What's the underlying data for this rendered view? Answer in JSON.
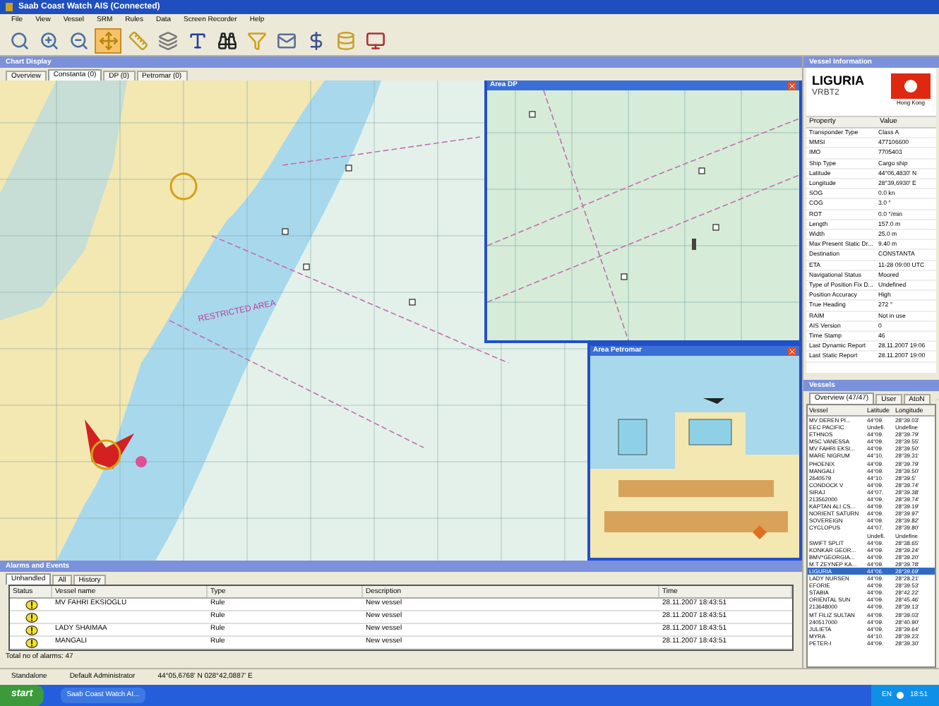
{
  "window": {
    "title": "Saab Coast Watch AIS (Connected)"
  },
  "menu": [
    "File",
    "View",
    "Vessel",
    "SRM",
    "Rules",
    "Data",
    "Screen Recorder",
    "Help"
  ],
  "toolbar": [
    {
      "kind": "search",
      "selected": false
    },
    {
      "kind": "zoom-in",
      "selected": false
    },
    {
      "kind": "zoom-out",
      "selected": false
    },
    {
      "kind": "pan",
      "selected": true
    },
    {
      "kind": "ruler",
      "selected": false
    },
    {
      "kind": "layers",
      "selected": false
    },
    {
      "kind": "text",
      "selected": false
    },
    {
      "kind": "binoculars",
      "selected": false
    },
    {
      "kind": "filter",
      "selected": false
    },
    {
      "kind": "mail",
      "selected": false
    },
    {
      "kind": "dollar",
      "selected": false
    },
    {
      "kind": "database",
      "selected": false
    },
    {
      "kind": "monitor",
      "selected": false
    }
  ],
  "chart_display": {
    "title": "Chart Display",
    "tabs": [
      {
        "label": "Overview",
        "selected": false
      },
      {
        "label": "Constanta (0)",
        "selected": true
      },
      {
        "label": "DP (0)",
        "selected": false
      },
      {
        "label": "Petromar (0)",
        "selected": false
      }
    ],
    "map_label": "RESTRICTED AREA",
    "area_windows": [
      {
        "title": "Area DP",
        "kind": "dp"
      },
      {
        "title": "Area Petromar",
        "kind": "harbor"
      }
    ]
  },
  "vessel_information": {
    "title": "Vessel Information",
    "name": "LIGURIA",
    "callsign": "VRBT2",
    "flag_caption": "Hong Kong",
    "columns": [
      "Property",
      "Value"
    ],
    "rows": [
      [
        "Transponder Type",
        "Class A"
      ],
      [
        "MMSI",
        "477106600"
      ],
      [
        "IMO",
        "7705403"
      ],
      [
        "Ship Type",
        "Cargo ship"
      ],
      [
        "Latitude",
        "44°06,4830' N"
      ],
      [
        "Longitude",
        "28°39,6930' E"
      ],
      [
        "SOG",
        "0.0 kn"
      ],
      [
        "COG",
        "3.0 °"
      ],
      [
        "ROT",
        "0.0 °/min"
      ],
      [
        "Length",
        "157.0 m"
      ],
      [
        "Width",
        "25.0 m"
      ],
      [
        "Max Present Static Dr...",
        "9.40 m"
      ],
      [
        "Destination",
        "CONSTANTA"
      ],
      [
        "ETA",
        "11-28 09:00 UTC"
      ],
      [
        "Navigational Status",
        "Moored"
      ],
      [
        "Type of Position Fix D...",
        "Undefined"
      ],
      [
        "Position Accuracy",
        "High"
      ],
      [
        "True Heading",
        "272 °"
      ],
      [
        "RAIM",
        "Not in use"
      ],
      [
        "AIS Version",
        "0"
      ],
      [
        "Time Stamp",
        "46"
      ],
      [
        "Last Dynamic Report",
        "28.11.2007 19:06"
      ],
      [
        "Last Static Report",
        "28.11.2007 19:00"
      ]
    ]
  },
  "vessels": {
    "title": "Vessels",
    "tabs": [
      {
        "label": "Overview (47/47)",
        "selected": true
      },
      {
        "label": "User",
        "selected": false
      },
      {
        "label": "AtoN",
        "selected": false
      }
    ],
    "columns": [
      "Vessel",
      "Latitude",
      "Longitude"
    ],
    "rows": [
      {
        "cells": [
          "MV DEREN PI...",
          "44°09.",
          "28°39.03'"
        ],
        "selected": false
      },
      {
        "cells": [
          "EEC PACIFIC",
          "Undefi.",
          "Undefine"
        ],
        "selected": false
      },
      {
        "cells": [
          "ETHNOS",
          "44°09.",
          "28°39.79'"
        ],
        "selected": false
      },
      {
        "cells": [
          "MSC VANESSA",
          "44°09.",
          "28°39.55'"
        ],
        "selected": false
      },
      {
        "cells": [
          "MV FAHRI EKSI...",
          "44°09.",
          "28°39.50'"
        ],
        "selected": false
      },
      {
        "cells": [
          "MARE NIGRUM",
          "44°10.",
          "28°39.31'"
        ],
        "selected": false
      },
      {
        "cells": [
          "PHOENIX",
          "44°09.",
          "28°39.79'"
        ],
        "selected": false
      },
      {
        "cells": [
          "MANGALI",
          "44°09.",
          "28°39.50'"
        ],
        "selected": false
      },
      {
        "cells": [
          "2640579",
          "44°10.",
          "28°39.5'"
        ],
        "selected": false
      },
      {
        "cells": [
          "CONDOCK V",
          "44°09.",
          "28°39.74'"
        ],
        "selected": false
      },
      {
        "cells": [
          "SIRAJ",
          "44°07.",
          "28°39.38'"
        ],
        "selected": false
      },
      {
        "cells": [
          "213562000",
          "44°09.",
          "28°39.74'"
        ],
        "selected": false
      },
      {
        "cells": [
          "KAPTAN ALI CS...",
          "44°09.",
          "28°39.19'"
        ],
        "selected": false
      },
      {
        "cells": [
          "NORIENT SATURN",
          "44°09.",
          "28°39.97'"
        ],
        "selected": false
      },
      {
        "cells": [
          "SOVEREIGN",
          "44°09.",
          "28°39.82'"
        ],
        "selected": false
      },
      {
        "cells": [
          "CYCLOPUS",
          "44°07.",
          "28°39.80'"
        ],
        "selected": false
      },
      {
        "cells": [
          "",
          "Undefi.",
          "Undefine"
        ],
        "selected": false
      },
      {
        "cells": [
          "SWIFT SPLIT",
          "44°09.",
          "28°38.65'"
        ],
        "selected": false
      },
      {
        "cells": [
          "KONKAR GEOR...",
          "44°09.",
          "28°39.24'"
        ],
        "selected": false
      },
      {
        "cells": [
          "BMV*GEORGIA...",
          "44°09.",
          "28°39.20'"
        ],
        "selected": false
      },
      {
        "cells": [
          "M.T ZEYNEP KA...",
          "44°09.",
          "28°39.78'"
        ],
        "selected": false
      },
      {
        "cells": [
          "LIGURIA",
          "44°06.",
          "28°39.69'"
        ],
        "selected": true
      },
      {
        "cells": [
          "LADY NURSEN",
          "44°09.",
          "28°28.21'"
        ],
        "selected": false
      },
      {
        "cells": [
          "EFORIE",
          "44°09.",
          "28°39.53'"
        ],
        "selected": false
      },
      {
        "cells": [
          "STABIA",
          "44°09.",
          "28°42.22'"
        ],
        "selected": false
      },
      {
        "cells": [
          "ORIENTAL SUN",
          "44°09.",
          "28°45.46'"
        ],
        "selected": false
      },
      {
        "cells": [
          "213648000",
          "44°09.",
          "28°39.13'"
        ],
        "selected": false
      },
      {
        "cells": [
          "MT FILIZ SULTAN",
          "44°09.",
          "28°39.03'"
        ],
        "selected": false
      },
      {
        "cells": [
          "240517000",
          "44°09.",
          "28°40.90'"
        ],
        "selected": false
      },
      {
        "cells": [
          "JULIETA",
          "44°09.",
          "28°39.64'"
        ],
        "selected": false
      },
      {
        "cells": [
          "MYRA",
          "44°10.",
          "28°39.23'"
        ],
        "selected": false
      },
      {
        "cells": [
          "PETER-I",
          "44°09.",
          "28°39.30'"
        ],
        "selected": false
      }
    ]
  },
  "alarms": {
    "title": "Alarms and Events",
    "tabs": [
      {
        "label": "Unhandled",
        "selected": true
      },
      {
        "label": "All",
        "selected": false
      },
      {
        "label": "History",
        "selected": false
      }
    ],
    "columns": [
      "Status",
      "Vessel name",
      "Type",
      "Description",
      "Time"
    ],
    "rows": [
      [
        "",
        "MV FAHRI EKSIOGLU",
        "Rule",
        "New vessel",
        "28.11.2007 18:43:51"
      ],
      [
        "",
        "",
        "Rule",
        "New vessel",
        "28.11.2007 18:43:51"
      ],
      [
        "",
        "LADY SHAIMAA",
        "Rule",
        "New vessel",
        "28.11.2007 18:43:51"
      ],
      [
        "",
        "MANGALI",
        "Rule",
        "New vessel",
        "28.11.2007 18:43:51"
      ]
    ],
    "total": "Total no of alarms: 47"
  },
  "status_bar": [
    "Standalone",
    "Default Administrator",
    "44°05,6768' N 028°42,0887' E"
  ],
  "taskbar": {
    "start": "start",
    "task": "Saab Coast Watch AI...",
    "language": "EN",
    "clock": "18:51"
  }
}
